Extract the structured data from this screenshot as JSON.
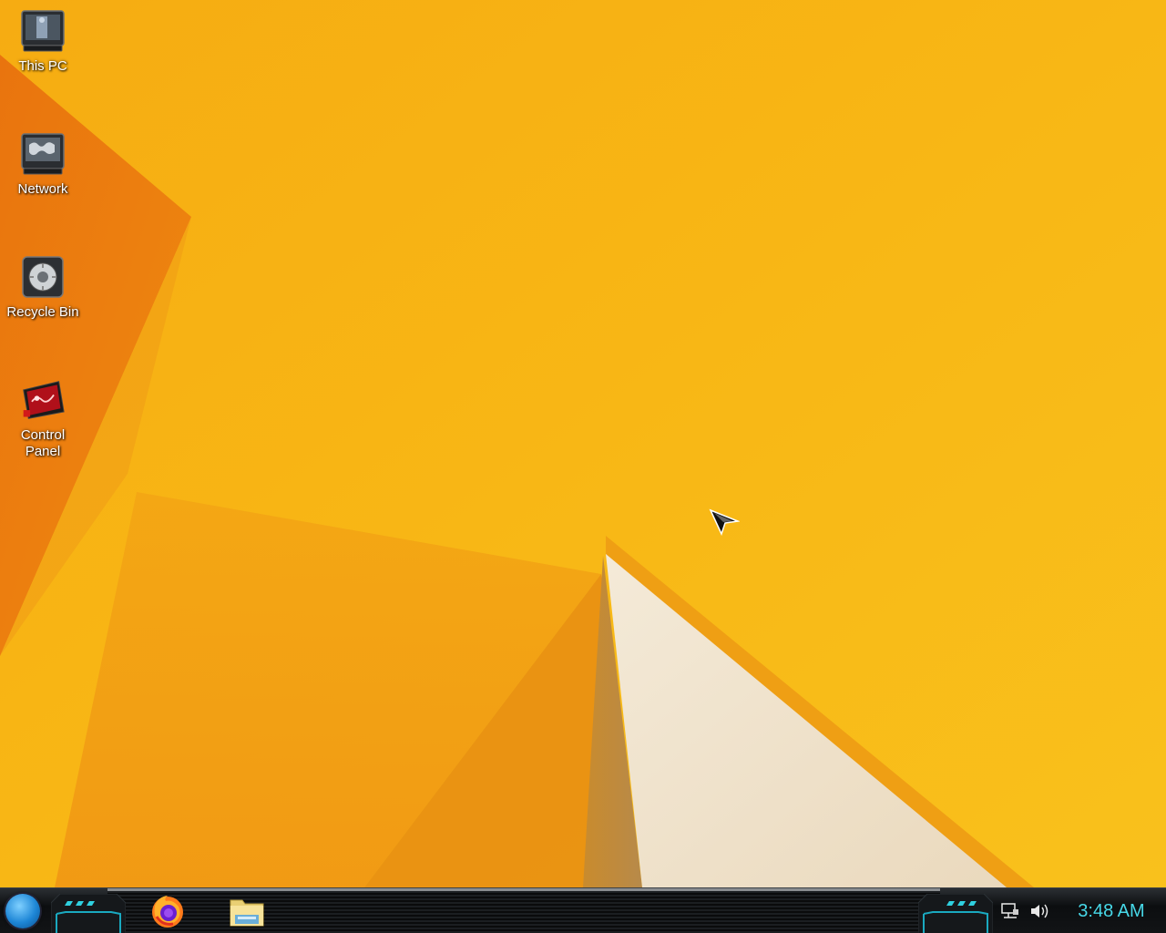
{
  "desktop": {
    "icons": [
      {
        "label": "This PC",
        "icon": "computer-icon"
      },
      {
        "label": "Network",
        "icon": "network-icon"
      },
      {
        "label": "Recycle Bin",
        "icon": "recycle-bin-icon"
      },
      {
        "label": "Control\nPanel",
        "icon": "control-panel-icon"
      }
    ],
    "wallpaper_colors": {
      "base": "#f7b515",
      "orange_left": "#e8730f",
      "cream": "#f1e3cc"
    }
  },
  "taskbar": {
    "start_icon": "start-orb-icon",
    "pinned": [
      {
        "app": "Firefox",
        "icon": "firefox-icon"
      },
      {
        "app": "File Explorer",
        "icon": "folder-icon"
      }
    ],
    "tray": {
      "icons": [
        "network-status-icon",
        "volume-icon"
      ],
      "clock": "3:48 AM"
    },
    "accent_color": "#47d8e8"
  }
}
